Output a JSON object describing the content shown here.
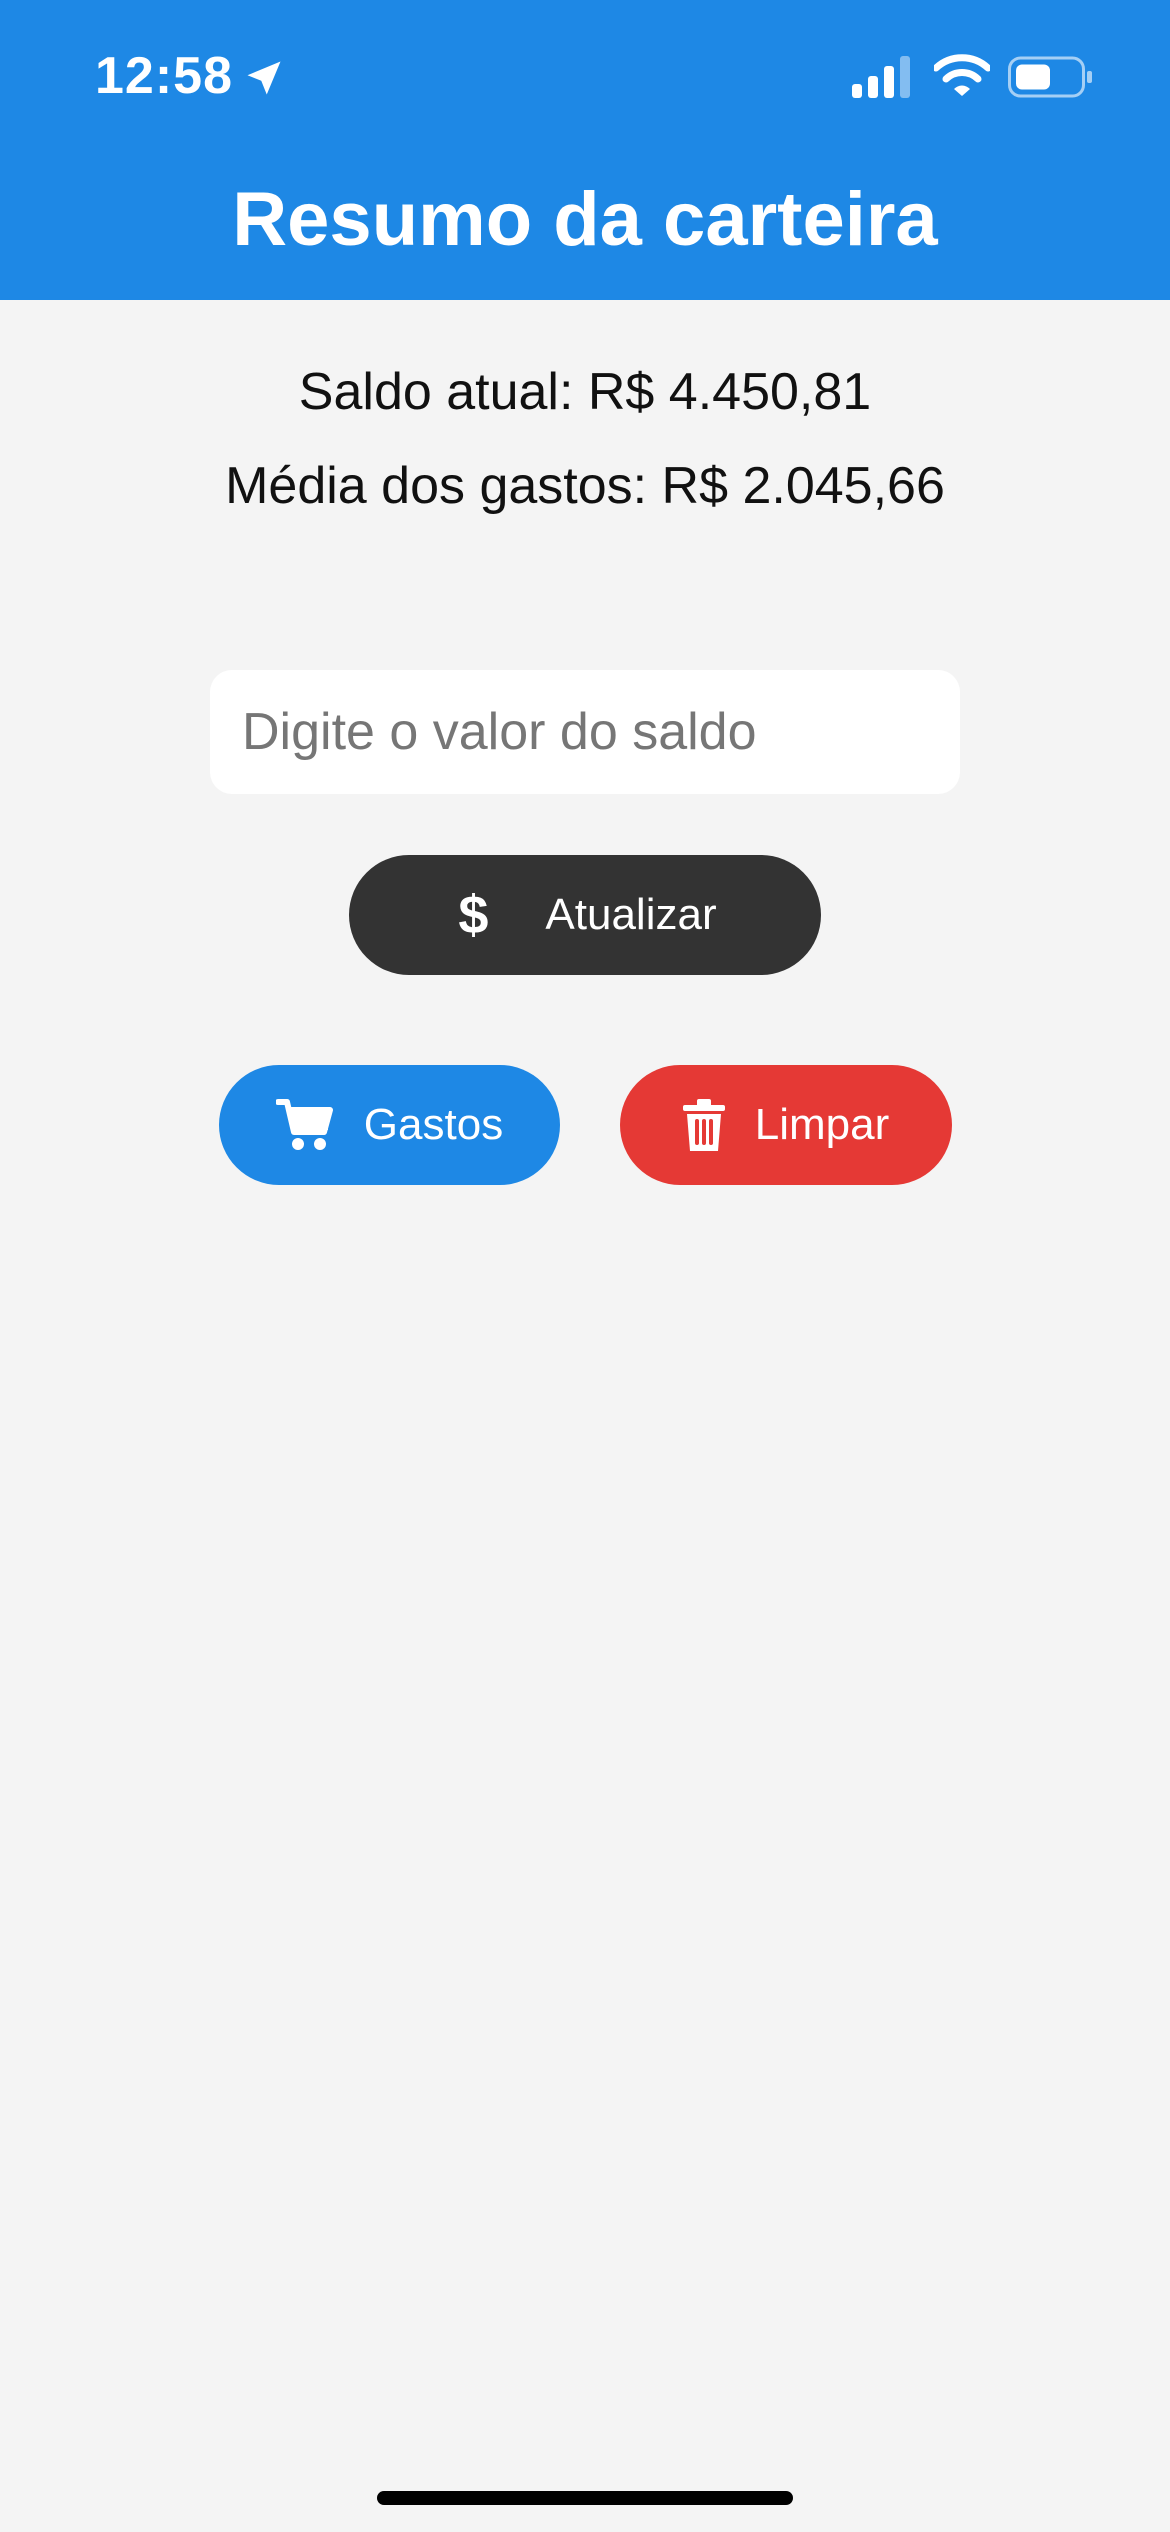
{
  "status_bar": {
    "time": "12:58",
    "icons": [
      "location-arrow-icon",
      "signal-icon",
      "wifi-icon",
      "battery-icon"
    ]
  },
  "header": {
    "title": "Resumo da carteira"
  },
  "summary": {
    "balance": "Saldo atual: R$ 4.450,81",
    "average": "Média dos gastos: R$ 2.045,66"
  },
  "balance_input": {
    "placeholder": "Digite o valor do saldo",
    "value": ""
  },
  "buttons": {
    "update": {
      "icon": "$",
      "label": "Atualizar"
    },
    "expenses": {
      "icon": "cart-icon",
      "label": "Gastos"
    },
    "clear": {
      "icon": "trash-icon",
      "label": "Limpar"
    }
  },
  "colors": {
    "header": "#1e88e5",
    "background": "#f4f4f4",
    "update_button": "#333333",
    "expenses_button": "#1e88e5",
    "clear_button": "#e53935"
  }
}
